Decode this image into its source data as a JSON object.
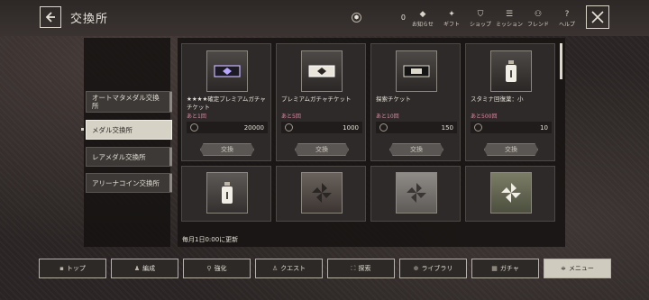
{
  "header": {
    "title": "交換所",
    "currency_value": "0",
    "icons": [
      {
        "name": "news",
        "label": "お知らせ",
        "glyph": "◆"
      },
      {
        "name": "gift",
        "label": "ギフト",
        "glyph": "✦"
      },
      {
        "name": "shop",
        "label": "ショップ",
        "glyph": "⛉"
      },
      {
        "name": "mission",
        "label": "ミッション",
        "glyph": "☰"
      },
      {
        "name": "friend",
        "label": "フレンド",
        "glyph": "⚇"
      },
      {
        "name": "help",
        "label": "ヘルプ",
        "glyph": "?"
      }
    ]
  },
  "sidebar": {
    "items": [
      {
        "label": "オートマタメダル交換所"
      },
      {
        "label": "メダル交換所"
      },
      {
        "label": "レアメダル交換所"
      },
      {
        "label": "アリーナコイン交換所"
      }
    ]
  },
  "items": [
    {
      "name": "★★★★確定プレミアムガチャチケット",
      "remaining": "あと1回",
      "price": "20000",
      "button": "交換"
    },
    {
      "name": "プレミアムガチャチケット",
      "remaining": "あと5回",
      "price": "1000",
      "button": "交換"
    },
    {
      "name": "探索チケット",
      "remaining": "あと10回",
      "price": "150",
      "button": "交換"
    },
    {
      "name": "スタミナ回復薬：小",
      "remaining": "あと500回",
      "price": "10",
      "button": "交換"
    }
  ],
  "footer_note": "毎月1日0:00に更新",
  "nav": [
    {
      "label": "トップ",
      "glyph": "▪"
    },
    {
      "label": "編成",
      "glyph": "♟"
    },
    {
      "label": "強化",
      "glyph": "⚲"
    },
    {
      "label": "クエスト",
      "glyph": "♙"
    },
    {
      "label": "探索",
      "glyph": "⛶"
    },
    {
      "label": "ライブラリ",
      "glyph": "⊕"
    },
    {
      "label": "ガチャ",
      "glyph": "▦"
    },
    {
      "label": "メニュー",
      "glyph": "≑"
    }
  ]
}
